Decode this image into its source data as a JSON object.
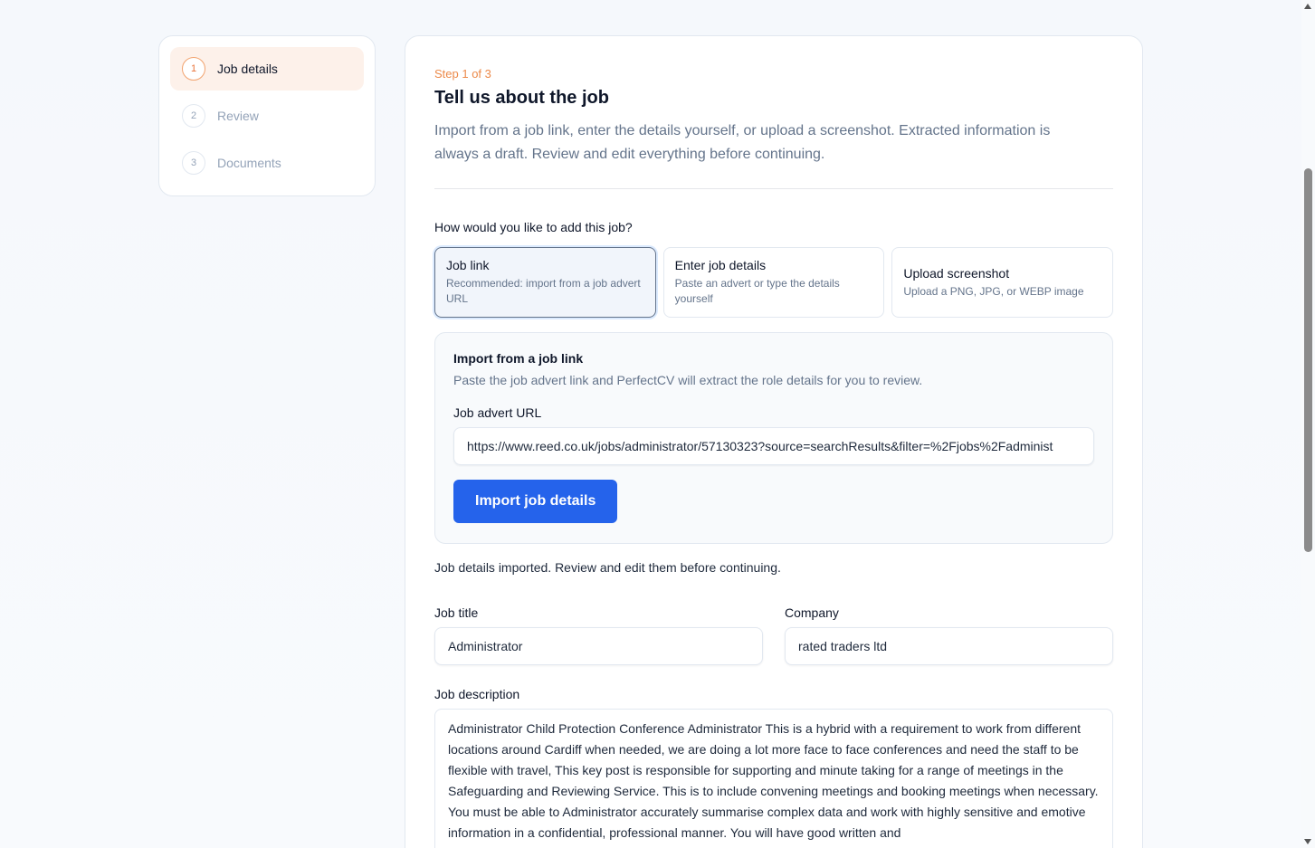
{
  "steps": [
    {
      "num": "1",
      "label": "Job details",
      "active": true
    },
    {
      "num": "2",
      "label": "Review",
      "active": false
    },
    {
      "num": "3",
      "label": "Documents",
      "active": false
    }
  ],
  "header": {
    "eyebrow": "Step 1 of 3",
    "title": "Tell us about the job",
    "subtitle": "Import from a job link, enter the details yourself, or upload a screenshot. Extracted information is always a draft. Review and edit everything before continuing."
  },
  "method": {
    "question": "How would you like to add this job?",
    "options": [
      {
        "title": "Job link",
        "desc": "Recommended: import from a job advert URL"
      },
      {
        "title": "Enter job details",
        "desc": "Paste an advert or type the details yourself"
      },
      {
        "title": "Upload screenshot",
        "desc": "Upload a PNG, JPG, or WEBP image"
      }
    ]
  },
  "import_panel": {
    "title": "Import from a job link",
    "desc": "Paste the job advert link and PerfectCV will extract the role details for you to review.",
    "url_label": "Job advert URL",
    "url_value": "https://www.reed.co.uk/jobs/administrator/57130323?source=searchResults&filter=%2Fjobs%2Fadminist",
    "button_label": "Import job details"
  },
  "status_message": "Job details imported. Review and edit them before continuing.",
  "form": {
    "job_title_label": "Job title",
    "job_title_value": "Administrator",
    "company_label": "Company",
    "company_value": "rated traders ltd",
    "description_label": "Job description",
    "description_value": "Administrator Child Protection Conference Administrator This is a hybrid with a requirement to work from different locations around Cardiff when needed, we are doing a lot more face to face conferences and need the staff to be flexible with travel, This key post is responsible for supporting and minute taking for a range of meetings in the Safeguarding and Reviewing Service. This is to include convening meetings and booking meetings when necessary. You must be able to Administrator accurately summarise complex data and work with highly sensitive and emotive information in a confidential, professional manner. You will have good written and"
  },
  "colors": {
    "accent_orange": "#ec8a4a",
    "primary_blue": "#2563eb",
    "active_step_bg": "#fdf1ea"
  }
}
